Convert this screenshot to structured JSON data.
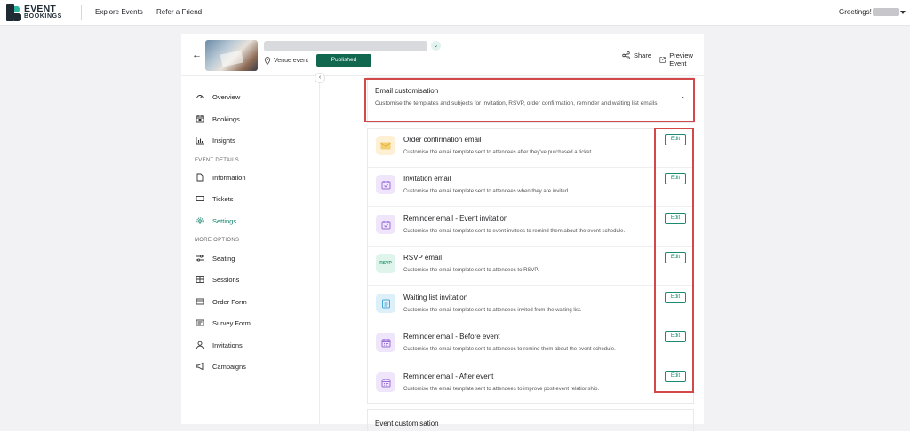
{
  "topbar": {
    "logo_line1": "EVENT",
    "logo_line2": "BOOKINGS",
    "nav": [
      "Explore Events",
      "Refer a Friend"
    ],
    "greeting": "Greetings!"
  },
  "event": {
    "venue_type": "Venue event",
    "status": "Published",
    "share_label": "Share",
    "preview_label": "Preview Event"
  },
  "sidebar": {
    "items_top": [
      {
        "label": "Overview",
        "icon": "gauge-icon"
      },
      {
        "label": "Bookings",
        "icon": "calendar-icon"
      },
      {
        "label": "Insights",
        "icon": "bar-chart-icon"
      }
    ],
    "section_details": "EVENT DETAILS",
    "items_details": [
      {
        "label": "Information",
        "icon": "document-icon"
      },
      {
        "label": "Tickets",
        "icon": "ticket-icon"
      },
      {
        "label": "Settings",
        "icon": "gear-icon",
        "active": true
      }
    ],
    "section_more": "MORE OPTIONS",
    "items_more": [
      {
        "label": "Seating",
        "icon": "sliders-icon"
      },
      {
        "label": "Sessions",
        "icon": "grid-icon"
      },
      {
        "label": "Order Form",
        "icon": "order-form-icon"
      },
      {
        "label": "Survey Form",
        "icon": "survey-icon"
      },
      {
        "label": "Invitations",
        "icon": "person-icon"
      },
      {
        "label": "Campaigns",
        "icon": "megaphone-icon"
      }
    ]
  },
  "email_section": {
    "title": "Email customisation",
    "description": "Customise the templates and subjects for invitation, RSVP, order confirmation, reminder and waiting list emails",
    "edit_label": "Edit",
    "emails": [
      {
        "name": "Order confirmation email",
        "desc": "Customise the email template sent to attendees after they've purchased a ticket.",
        "icon": "envelope-icon",
        "icon_bg": "#fdf0d4",
        "icon_color": "#e9b949"
      },
      {
        "name": "Invitation email",
        "desc": "Customise the email template sent to attendees when they are invited.",
        "icon": "calendar-check-icon",
        "icon_bg": "#efe6fb",
        "icon_color": "#9b6fd8"
      },
      {
        "name": "Reminder email - Event invitation",
        "desc": "Customise the email template sent to event invitees to remind them about the event schedule.",
        "icon": "calendar-check-icon",
        "icon_bg": "#efe6fb",
        "icon_color": "#9b6fd8"
      },
      {
        "name": "RSVP email",
        "desc": "Customise the email template sent to attendees to RSVP.",
        "icon": "rsvp-icon",
        "icon_bg": "#dff4ea",
        "icon_color": "#2f9a71",
        "icon_text": "RSVP"
      },
      {
        "name": "Waiting list invitation",
        "desc": "Customise the email template sent to attendees invited from the waiting list.",
        "icon": "list-icon",
        "icon_bg": "#ddf0fa",
        "icon_color": "#4aa6d6"
      },
      {
        "name": "Reminder email - Before event",
        "desc": "Customise the email template sent to attendees to remind them about the event schedule.",
        "icon": "calendar-icon",
        "icon_bg": "#efe6fb",
        "icon_color": "#9b6fd8"
      },
      {
        "name": "Reminder email - After event",
        "desc": "Customise the email template sent to attendees to improve post-event relationship.",
        "icon": "calendar-icon",
        "icon_bg": "#efe6fb",
        "icon_color": "#9b6fd8"
      }
    ]
  },
  "next_section": {
    "title": "Event customisation"
  },
  "colors": {
    "brand": "#12684f",
    "accent": "#1b8a70",
    "highlight": "#d34848"
  }
}
